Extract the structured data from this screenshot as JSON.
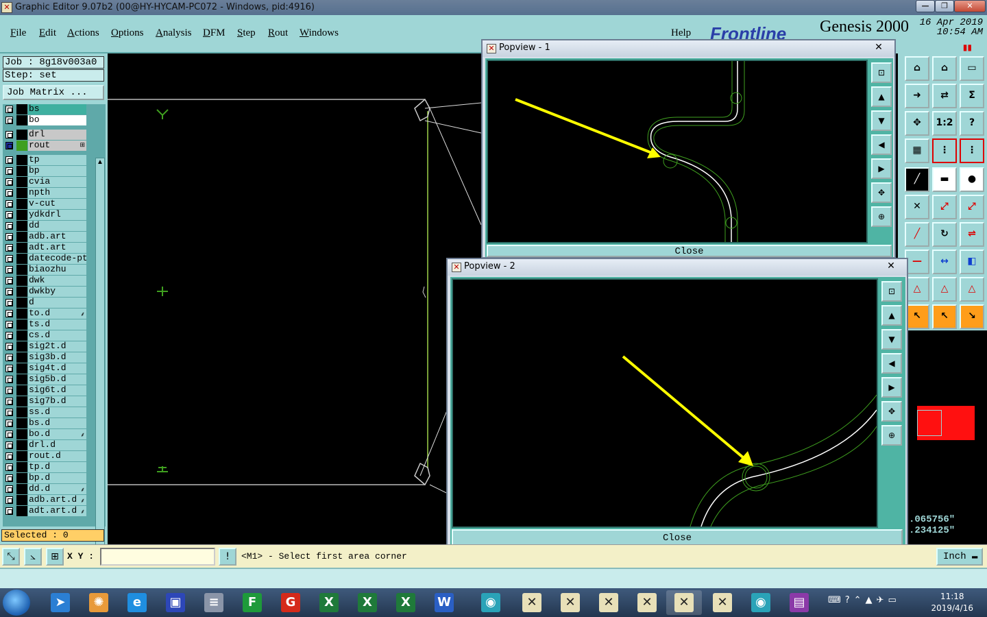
{
  "window": {
    "title": "Graphic Editor 9.07b2 (00@HY-HYCAM-PC072 - Windows, pid:4916)",
    "minimize": "—",
    "maximize": "❐",
    "close": "✕"
  },
  "menu": {
    "items": [
      "File",
      "Edit",
      "Actions",
      "Options",
      "Analysis",
      "DFM",
      "Step",
      "Rout",
      "Windows"
    ],
    "help": "Help"
  },
  "brand": {
    "logo": "Frontline",
    "product": "Genesis 2000",
    "date": "16 Apr 2019",
    "time": "10:54 AM"
  },
  "job": {
    "job_label": "Job : 8g18v003a0",
    "step_label": "Step: set",
    "matrix_button": "Job Matrix ..."
  },
  "layers": [
    {
      "name": "bs",
      "mark": ""
    },
    {
      "name": "bo",
      "mark": ""
    },
    {
      "name": "drl",
      "mark": ""
    },
    {
      "name": "rout",
      "mark": "⊞"
    },
    {
      "name": "tp",
      "mark": ""
    },
    {
      "name": "bp",
      "mark": ""
    },
    {
      "name": "cvia",
      "mark": ""
    },
    {
      "name": "npth",
      "mark": ""
    },
    {
      "name": "v-cut",
      "mark": ""
    },
    {
      "name": "ydkdrl",
      "mark": ""
    },
    {
      "name": "dd",
      "mark": ""
    },
    {
      "name": "adb.art",
      "mark": ""
    },
    {
      "name": "adt.art",
      "mark": ""
    },
    {
      "name": "datecode-pte",
      "mark": ""
    },
    {
      "name": "biaozhu",
      "mark": ""
    },
    {
      "name": "dwk",
      "mark": ""
    },
    {
      "name": "dwkby",
      "mark": ""
    },
    {
      "name": "d",
      "mark": ""
    },
    {
      "name": "to.d",
      "mark": "⸙"
    },
    {
      "name": "ts.d",
      "mark": ""
    },
    {
      "name": "cs.d",
      "mark": ""
    },
    {
      "name": "sig2t.d",
      "mark": ""
    },
    {
      "name": "sig3b.d",
      "mark": ""
    },
    {
      "name": "sig4t.d",
      "mark": ""
    },
    {
      "name": "sig5b.d",
      "mark": ""
    },
    {
      "name": "sig6t.d",
      "mark": ""
    },
    {
      "name": "sig7b.d",
      "mark": ""
    },
    {
      "name": "ss.d",
      "mark": ""
    },
    {
      "name": "bs.d",
      "mark": ""
    },
    {
      "name": "bo.d",
      "mark": "⸙"
    },
    {
      "name": "drl.d",
      "mark": ""
    },
    {
      "name": "rout.d",
      "mark": ""
    },
    {
      "name": "tp.d",
      "mark": ""
    },
    {
      "name": "bp.d",
      "mark": ""
    },
    {
      "name": "dd.d",
      "mark": "⸙"
    },
    {
      "name": "adb.art.d",
      "mark": "⸙"
    },
    {
      "name": "adt.art.d",
      "mark": "⸙"
    }
  ],
  "selected": "Selected : 0",
  "command": {
    "xy_label": "X Y :",
    "xy_value": "",
    "message": "<M1> - Select first area corner",
    "units": "Inch ▬"
  },
  "readout": {
    "x": ".065756\"",
    "y": ".234125\""
  },
  "popview1": {
    "title": "Popview - 1",
    "close": "Close",
    "close_x": "✕"
  },
  "popview2": {
    "title": "Popview - 2",
    "close": "Close",
    "close_x": "✕"
  },
  "taskbar": {
    "time": "11:18",
    "date": "2019/4/16"
  },
  "colors": {
    "panel": "#9fd6d6",
    "canvas": "#000000",
    "arrow": "#ffff00",
    "profile": "#3f9f1f",
    "selected_bg": "#ffcf66"
  }
}
